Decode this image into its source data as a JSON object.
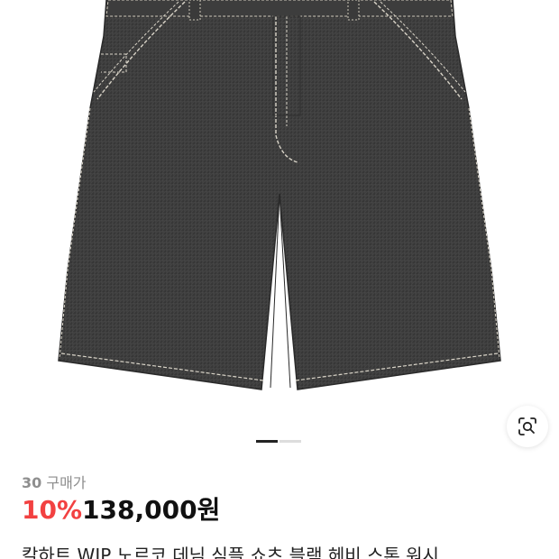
{
  "product": {
    "image_alt": "black stone wash denim shorts",
    "image_icon": "denim-shorts-image",
    "buyers_count": "30",
    "buyers_label": "구매가",
    "discount": "10%",
    "price": "138,000원",
    "title": "칼하트 WIP 노르코 데님 심플 쇼츠 블랙 헤비 스톤 워시"
  },
  "gallery": {
    "pages": 2,
    "active_page": 1
  },
  "icons": {
    "lens": "lens-search-icon"
  },
  "colors": {
    "discount": "#f24141",
    "text": "#111111",
    "muted": "#8e8e8e",
    "denim": "#3b3b3b",
    "stitch": "#d9d4c8"
  }
}
